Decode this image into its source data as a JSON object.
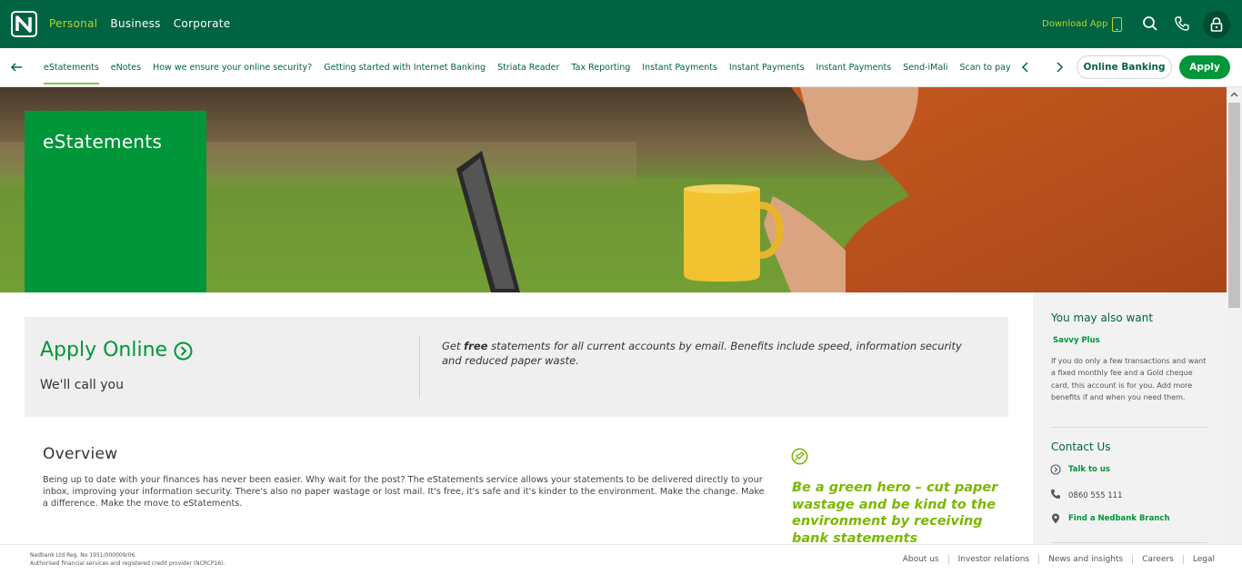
{
  "topnav": {
    "personal": "Personal",
    "business": "Business",
    "corporate": "Corporate",
    "download_app": "Download App"
  },
  "subnav": {
    "items": [
      "eStatements",
      "eNotes",
      "How we ensure your online security?",
      "Getting started with Internet Banking",
      "Striata Reader",
      "Tax Reporting",
      "Instant Payments",
      "Instant Payments",
      "Instant Payments",
      "Send-iMali",
      "Scan to pay"
    ],
    "online_banking": "Online Banking",
    "apply": "Apply"
  },
  "hero": {
    "title": "eStatements"
  },
  "apply_panel": {
    "title": "Apply Online",
    "subtitle": "We'll call you",
    "desc_prefix": "Get ",
    "desc_bold": "free",
    "desc_rest": " statements for all current accounts by email. Benefits include speed, information security and reduced paper waste."
  },
  "overview": {
    "heading": "Overview",
    "body": "Being up to date with your finances has never been easier. Why wait for the post? The eStatements service allows your statements to be delivered directly to your inbox, improving your information security. There's also no paper wastage or lost mail. It's free, it's safe and it's kinder to the environment. Make the change. Make a difference. Make the move to eStatements."
  },
  "quote": "Be a green hero – cut paper wastage and be kind to the environment by receiving bank statements electronically.",
  "sidebar": {
    "may_want": "You may also want",
    "savvy": "Savvy Plus",
    "savvy_desc": "If you do only a few transactions and want a fixed monthly fee and a Gold cheque card, this account is for you. Add more benefits if and when you need them.",
    "contact": "Contact Us",
    "talk": "Talk to us",
    "phone": "0860 555 111",
    "branch": "Find a Nedbank Branch"
  },
  "footer": {
    "reg_line1": "Nedbank Ltd Reg. No 1951/000009/06.",
    "reg_line2": "Authorised financial services and registered credit provider (NCRCP16).",
    "links": [
      "About us",
      "Investor relations",
      "News and insights",
      "Careers",
      "Legal"
    ]
  },
  "colors": {
    "brand_dark": "#006341",
    "brand_green": "#009639",
    "accent_lime": "#b8d332",
    "quote_green": "#7ab800"
  }
}
